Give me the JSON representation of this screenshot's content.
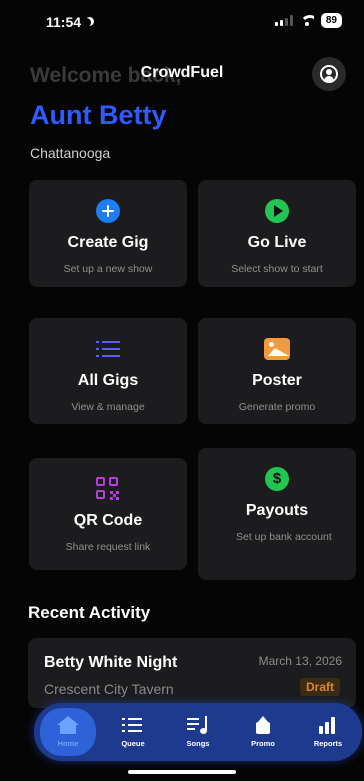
{
  "status_bar": {
    "time": "11:54",
    "battery": "89"
  },
  "header": {
    "welcome": "Welcome back,",
    "app_title": "CrowdFuel",
    "user_name": "Aunt Betty",
    "city": "Chattanooga"
  },
  "actions": [
    {
      "title": "Create Gig",
      "subtitle": "Set up a new show",
      "icon": "plus-circle-icon",
      "color": "#1e7cf5"
    },
    {
      "title": "Go Live",
      "subtitle": "Select show to start",
      "icon": "play-circle-icon",
      "color": "#23c552"
    },
    {
      "title": "All Gigs",
      "subtitle": "View & manage",
      "icon": "list-icon",
      "color": "#5b5bff"
    },
    {
      "title": "Poster",
      "subtitle": "Generate promo",
      "icon": "photo-icon",
      "color": "#f39a3c"
    },
    {
      "title": "QR Code",
      "subtitle": "Share request link",
      "icon": "qr-code-icon",
      "color": "#b53fd8"
    },
    {
      "title": "Payouts",
      "subtitle": "Set up bank account",
      "icon": "dollar-circle-icon",
      "color": "#23c552"
    }
  ],
  "recent": {
    "section_title": "Recent Activity",
    "items": [
      {
        "name": "Betty White Night",
        "venue": "Crescent City Tavern",
        "date": "March 13, 2026",
        "status": "Draft"
      }
    ]
  },
  "tabs": [
    {
      "label": "Home",
      "icon": "home-icon",
      "active": true
    },
    {
      "label": "Queue",
      "icon": "queue-icon"
    },
    {
      "label": "Songs",
      "icon": "music-note-icon"
    },
    {
      "label": "Promo",
      "icon": "share-icon"
    },
    {
      "label": "Reports",
      "icon": "bar-chart-icon"
    }
  ],
  "colors": {
    "accent": "#2d5bff",
    "tab_bar": "#1e3a8f",
    "card": "#1c1c1e",
    "draft": "#d98a2b"
  }
}
